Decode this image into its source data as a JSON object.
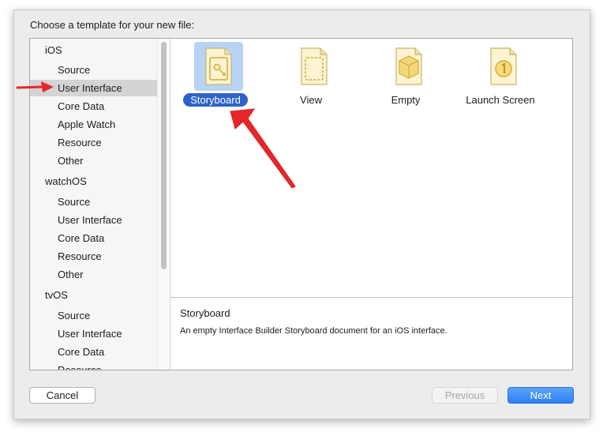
{
  "dialog": {
    "prompt": "Choose a template for your new file:"
  },
  "sidebar": {
    "groups": [
      {
        "label": "iOS",
        "items": [
          "Source",
          "User Interface",
          "Core Data",
          "Apple Watch",
          "Resource",
          "Other"
        ]
      },
      {
        "label": "watchOS",
        "items": [
          "Source",
          "User Interface",
          "Core Data",
          "Resource",
          "Other"
        ]
      },
      {
        "label": "tvOS",
        "items": [
          "Source",
          "User Interface",
          "Core Data",
          "Resource"
        ]
      }
    ],
    "selected": "User Interface"
  },
  "templates": [
    {
      "label": "Storyboard",
      "icon": "storyboard-icon",
      "selected": true
    },
    {
      "label": "View",
      "icon": "view-icon",
      "selected": false
    },
    {
      "label": "Empty",
      "icon": "empty-cube-icon",
      "selected": false
    },
    {
      "label": "Launch Screen",
      "icon": "launch-screen-icon",
      "selected": false
    }
  ],
  "description": {
    "title": "Storyboard",
    "text": "An empty Interface Builder Storyboard document for an iOS interface."
  },
  "buttons": {
    "cancel": "Cancel",
    "previous": "Previous",
    "next": "Next"
  },
  "colors": {
    "accent": "#2e62c8",
    "selection_highlight": "#b7d3f5",
    "annotation_arrow": "#e8262a"
  }
}
